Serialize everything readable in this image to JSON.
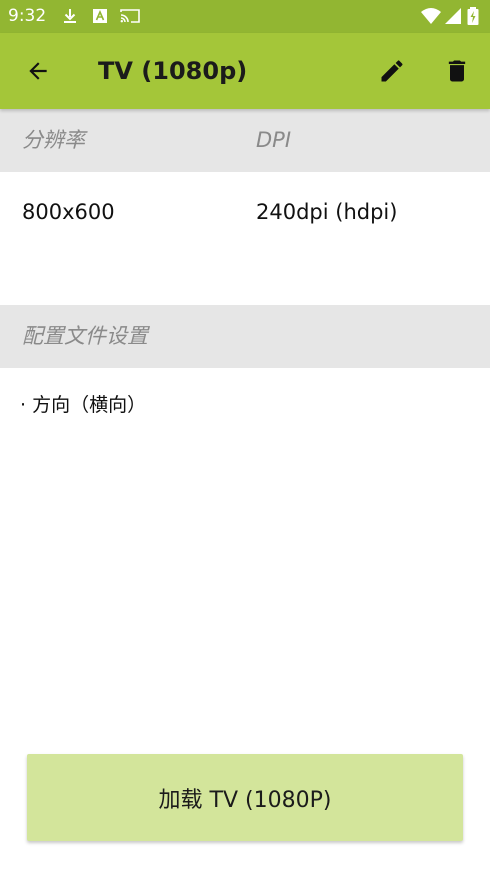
{
  "status_bar": {
    "time": "9:32",
    "icons": [
      "download-icon",
      "text-a-icon",
      "cast-icon",
      "wifi-icon",
      "cellular-signal-icon",
      "battery-charging-icon"
    ]
  },
  "app_bar": {
    "title": "TV (1080p)",
    "icons": [
      "back-arrow-icon",
      "pencil-icon",
      "trash-icon"
    ]
  },
  "resolution_section": {
    "resolution_header": "分辨率",
    "dpi_header": "DPI",
    "resolution_value": "800x600",
    "dpi_value": "240dpi (hdpi)"
  },
  "profile_section": {
    "header": "配置文件设置",
    "items": [
      "· 方向（横向）"
    ]
  },
  "load_button": {
    "label": "加载 TV (1080P)"
  },
  "colors": {
    "status_bar": "#92b632",
    "app_bar": "#a4c639",
    "section_header": "#e6e6e6",
    "button": "#d3e59b"
  }
}
